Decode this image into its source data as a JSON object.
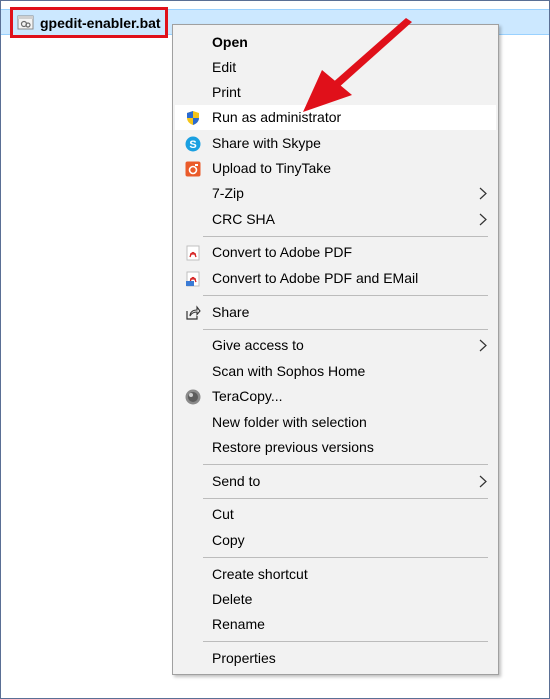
{
  "file": {
    "name": "gpedit-enabler.bat"
  },
  "menu": {
    "items": [
      {
        "label": "Open"
      },
      {
        "label": "Edit"
      },
      {
        "label": "Print"
      },
      {
        "label": "Run as administrator"
      },
      {
        "label": "Share with Skype"
      },
      {
        "label": "Upload to TinyTake"
      },
      {
        "label": "7-Zip"
      },
      {
        "label": "CRC SHA"
      },
      {
        "label": "Convert to Adobe PDF"
      },
      {
        "label": "Convert to Adobe PDF and EMail"
      },
      {
        "label": "Share"
      },
      {
        "label": "Give access to"
      },
      {
        "label": "Scan with Sophos Home"
      },
      {
        "label": "TeraCopy..."
      },
      {
        "label": "New folder with selection"
      },
      {
        "label": "Restore previous versions"
      },
      {
        "label": "Send to"
      },
      {
        "label": "Cut"
      },
      {
        "label": "Copy"
      },
      {
        "label": "Create shortcut"
      },
      {
        "label": "Delete"
      },
      {
        "label": "Rename"
      },
      {
        "label": "Properties"
      }
    ]
  },
  "colors": {
    "highlight_red": "#e0101a",
    "selection_blue": "#cce8ff"
  }
}
